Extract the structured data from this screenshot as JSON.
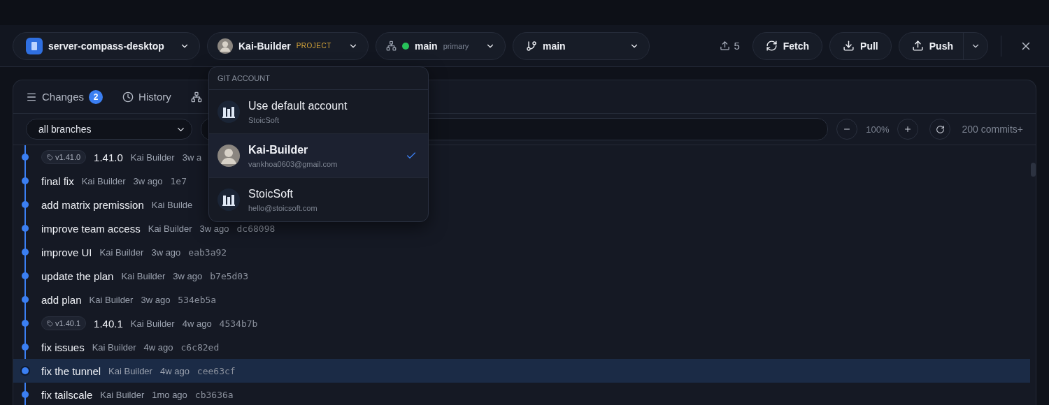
{
  "toolbar": {
    "repo": {
      "name": "server-compass-desktop"
    },
    "account": {
      "name": "Kai-Builder",
      "badge": "PROJECT"
    },
    "worktree": {
      "name": "main",
      "note": "primary",
      "online": true
    },
    "branch": {
      "name": "main"
    },
    "ahead": "5",
    "buttons": [
      {
        "kind": "fetch",
        "label": "Fetch"
      },
      {
        "kind": "pull",
        "label": "Pull"
      },
      {
        "kind": "push",
        "label": "Push"
      }
    ]
  },
  "tabs": [
    {
      "kind": "changes",
      "label": "Changes",
      "count": "2"
    },
    {
      "kind": "history",
      "label": "History"
    },
    {
      "kind": "tree"
    }
  ],
  "filter": {
    "branch": "all branches",
    "zoom": "100%",
    "commits": "200 commits+"
  },
  "commits": [
    {
      "tag": "v1.41.0",
      "message": "1.41.0",
      "author": "Kai Builder",
      "time": "3w a",
      "selected": false
    },
    {
      "message": "final fix",
      "author": "Kai Builder",
      "time": "3w ago",
      "hash": "1e7",
      "selected": false
    },
    {
      "message": "add matrix premission",
      "author": "Kai Builde",
      "selected": false
    },
    {
      "message": "improve team access",
      "author": "Kai Builder",
      "time": "3w ago",
      "hash": "dc68098",
      "selected": false
    },
    {
      "message": "improve UI",
      "author": "Kai Builder",
      "time": "3w ago",
      "hash": "eab3a92",
      "selected": false
    },
    {
      "message": "update the plan",
      "author": "Kai Builder",
      "time": "3w ago",
      "hash": "b7e5d03",
      "selected": false
    },
    {
      "message": "add plan",
      "author": "Kai Builder",
      "time": "3w ago",
      "hash": "534eb5a",
      "selected": false
    },
    {
      "tag": "v1.40.1",
      "message": "1.40.1",
      "author": "Kai Builder",
      "time": "4w ago",
      "hash": "4534b7b",
      "selected": false
    },
    {
      "message": "fix issues",
      "author": "Kai Builder",
      "time": "4w ago",
      "hash": "c6c82ed",
      "selected": false
    },
    {
      "message": "fix the tunnel",
      "author": "Kai Builder",
      "time": "4w ago",
      "hash": "cee63cf",
      "selected": true
    },
    {
      "message": "fix tailscale",
      "author": "Kai Builder",
      "time": "1mo ago",
      "hash": "cb3636a",
      "selected": false
    }
  ],
  "account_menu": {
    "heading": "GIT ACCOUNT",
    "items": [
      {
        "kind": "logo",
        "name": "Use default account",
        "detail": "StoicSoft",
        "selected": false
      },
      {
        "kind": "photo",
        "name": "Kai-Builder",
        "detail": "vankhoa0603@gmail.com",
        "selected": true
      },
      {
        "kind": "logo",
        "name": "StoicSoft",
        "detail": "hello@stoicsoft.com",
        "selected": false
      }
    ]
  }
}
